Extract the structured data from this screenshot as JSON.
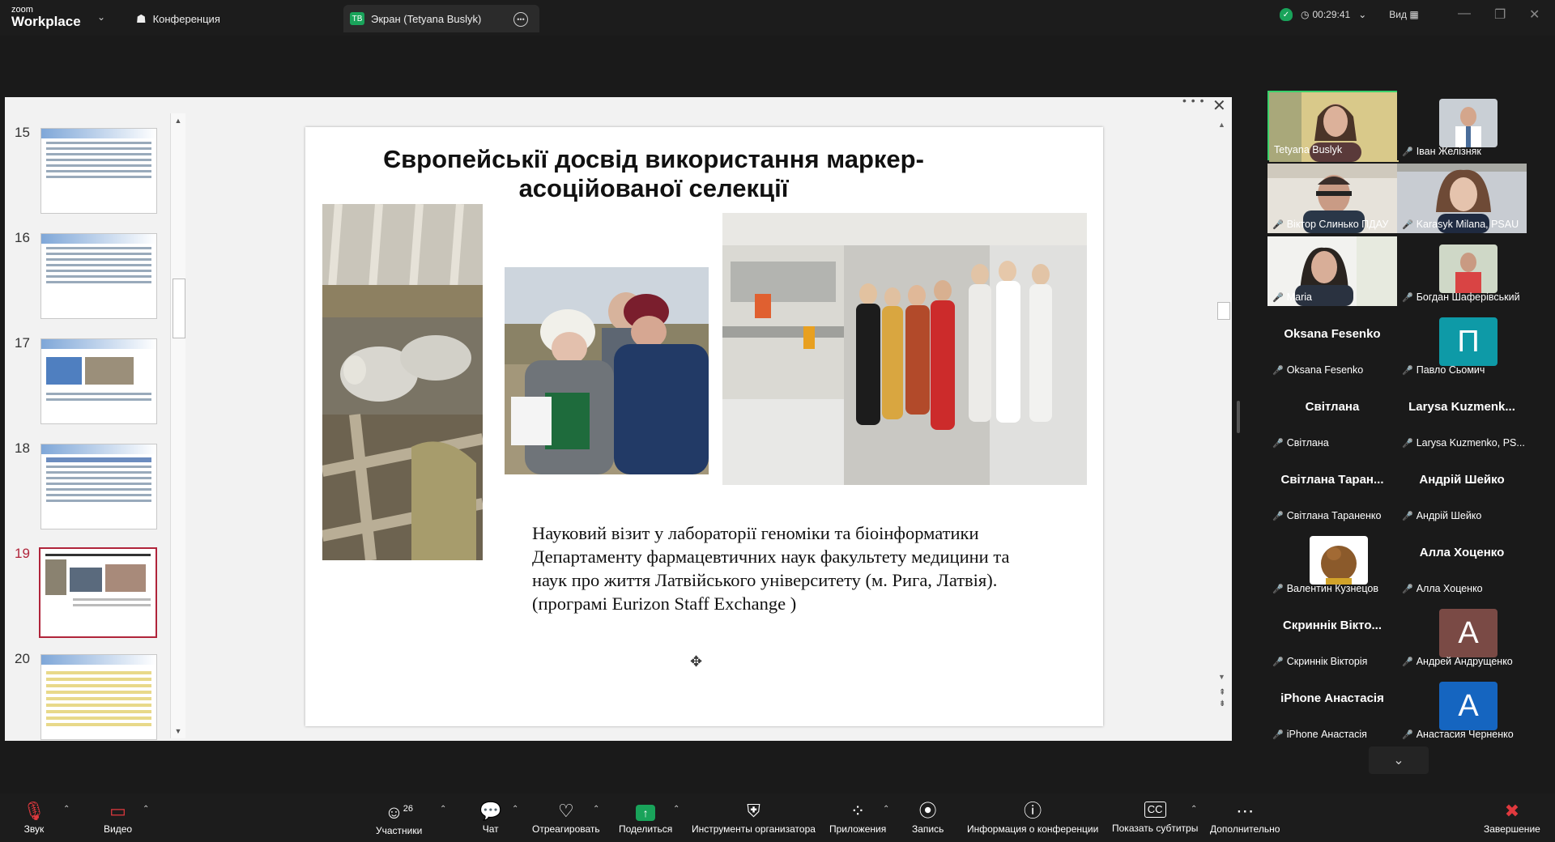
{
  "app": {
    "logo_line1": "zoom",
    "logo_line2": "Workplace"
  },
  "tabs": [
    {
      "label": "Конференция"
    },
    {
      "label": "Экран (Tetyana Buslyk)",
      "badge": "TB"
    }
  ],
  "status": {
    "timer": "00:29:41",
    "view_label": "Вид"
  },
  "slides_panel": {
    "numbers": [
      "15",
      "16",
      "17",
      "18",
      "19",
      "20"
    ],
    "selected": "19"
  },
  "slide": {
    "title_line1": "Європейськії досвід використання маркер-",
    "title_line2": "асоційованої селекції",
    "caption": "Науковий візит у лабораторії геноміки та біоінформатики Департаменту фармацевтичних наук факультету медицини та наук про життя Латвійського університету (м. Рига, Латвія). (програмі Eurizon Staff Exchange )"
  },
  "participants": [
    {
      "name": "Tetyana Buslyk",
      "type": "video",
      "muted": false
    },
    {
      "name": "Іван Желізняк",
      "type": "photo",
      "muted": true
    },
    {
      "name": "Віктор Слинько ПДАУ",
      "type": "video",
      "muted": true
    },
    {
      "name": "Karasyk Milana, PSAU",
      "type": "video",
      "muted": true
    },
    {
      "name": "Maria",
      "type": "video",
      "muted": true
    },
    {
      "name": "Богдан Шаферівський",
      "type": "photo",
      "muted": true
    },
    {
      "big": "Oksana Fesenko",
      "name": "Oksana Fesenko",
      "type": "name",
      "muted": true
    },
    {
      "name": "Павло Сьомич",
      "type": "letter",
      "letter": "П",
      "color": "#0e9aa7",
      "muted": true
    },
    {
      "big": "Світлана",
      "name": "Світлана",
      "type": "name",
      "muted": true
    },
    {
      "big": "Larysa Kuzmenk...",
      "name": "Larysa Kuzmenko, PS...",
      "type": "name",
      "muted": true
    },
    {
      "big": "Світлана Таран...",
      "name": "Світлана Тараненко",
      "type": "name",
      "muted": true
    },
    {
      "big": "Андрій Шейко",
      "name": "Андрій Шейко",
      "type": "name",
      "muted": true
    },
    {
      "name": "Валентин Кузнецов",
      "type": "photo",
      "muted": true
    },
    {
      "big": "Алла Хоценко",
      "name": "Алла Хоценко",
      "type": "name",
      "muted": true
    },
    {
      "big": "Скриннік Вікто...",
      "name": "Скриннік Вікторія",
      "type": "name",
      "muted": true
    },
    {
      "name": "Андрей Андрущенко",
      "type": "letter",
      "letter": "А",
      "color": "#7a4a45",
      "muted": true
    },
    {
      "big": "iPhone Анастасія",
      "name": "iPhone Анастасія",
      "type": "name",
      "muted": true
    },
    {
      "name": "Анастасия Черненко",
      "type": "letter",
      "letter": "А",
      "color": "#1565c0",
      "muted": true
    }
  ],
  "toolbar": {
    "audio": "Звук",
    "video": "Видео",
    "participants": "Участники",
    "participants_count": "26",
    "chat": "Чат",
    "react": "Отреагировать",
    "share": "Поделиться",
    "host_tools": "Инструменты организатора",
    "apps": "Приложения",
    "record": "Запись",
    "info": "Информация о конференции",
    "captions": "Показать субтитры",
    "more": "Дополнительно",
    "end": "Завершение"
  },
  "colors": {
    "accent_green": "#19a35a",
    "mute_red": "#e0393e",
    "selected_slide": "#b0243a"
  }
}
